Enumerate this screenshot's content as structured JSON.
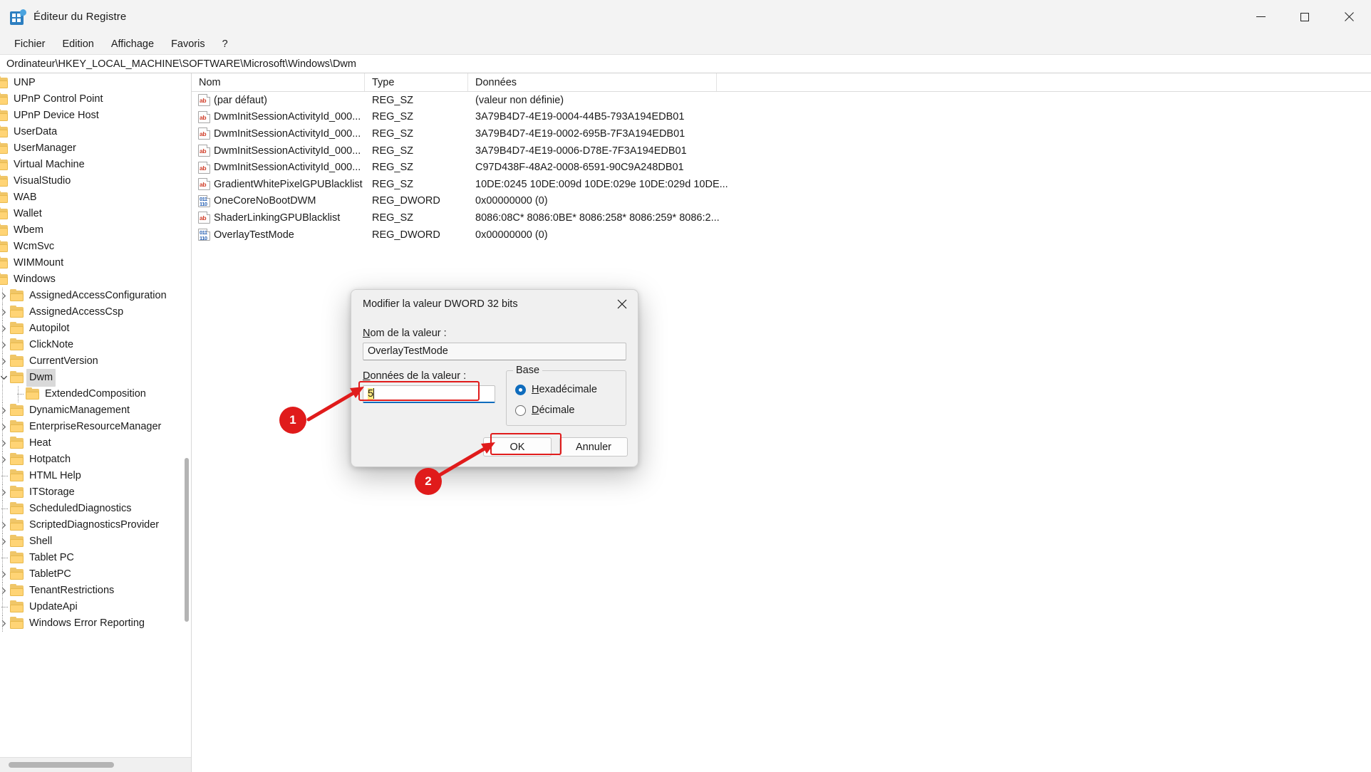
{
  "window": {
    "title": "Éditeur du Registre",
    "icon": "registry-editor-icon",
    "minimize_label": "Réduire",
    "maximize_label": "Agrandir",
    "close_label": "Fermer"
  },
  "menu": {
    "items": [
      {
        "label": "Fichier"
      },
      {
        "label": "Edition"
      },
      {
        "label": "Affichage"
      },
      {
        "label": "Favoris"
      },
      {
        "label": "?"
      }
    ]
  },
  "address": {
    "path": "Ordinateur\\HKEY_LOCAL_MACHINE\\SOFTWARE\\Microsoft\\Windows\\Dwm"
  },
  "tree": {
    "nodes": [
      {
        "label": "UNP",
        "indent": 1,
        "expander": "collapsed",
        "selected": false
      },
      {
        "label": "UPnP Control Point",
        "indent": 1,
        "expander": "none",
        "selected": false
      },
      {
        "label": "UPnP Device Host",
        "indent": 1,
        "expander": "collapsed",
        "selected": false
      },
      {
        "label": "UserData",
        "indent": 1,
        "expander": "none",
        "selected": false
      },
      {
        "label": "UserManager",
        "indent": 1,
        "expander": "collapsed",
        "selected": false
      },
      {
        "label": "Virtual Machine",
        "indent": 1,
        "expander": "collapsed",
        "selected": false
      },
      {
        "label": "VisualStudio",
        "indent": 1,
        "expander": "collapsed",
        "selected": false
      },
      {
        "label": "WAB",
        "indent": 1,
        "expander": "collapsed",
        "selected": false
      },
      {
        "label": "Wallet",
        "indent": 1,
        "expander": "none",
        "selected": false
      },
      {
        "label": "Wbem",
        "indent": 1,
        "expander": "collapsed",
        "selected": false
      },
      {
        "label": "WcmSvc",
        "indent": 1,
        "expander": "collapsed",
        "selected": false
      },
      {
        "label": "WIMMount",
        "indent": 1,
        "expander": "collapsed",
        "selected": false
      },
      {
        "label": "Windows",
        "indent": 1,
        "expander": "expanded",
        "selected": false
      },
      {
        "label": "AssignedAccessConfiguration",
        "indent": 2,
        "expander": "collapsed",
        "selected": false
      },
      {
        "label": "AssignedAccessCsp",
        "indent": 2,
        "expander": "collapsed",
        "selected": false
      },
      {
        "label": "Autopilot",
        "indent": 2,
        "expander": "collapsed",
        "selected": false
      },
      {
        "label": "ClickNote",
        "indent": 2,
        "expander": "collapsed",
        "selected": false
      },
      {
        "label": "CurrentVersion",
        "indent": 2,
        "expander": "collapsed",
        "selected": false
      },
      {
        "label": "Dwm",
        "indent": 2,
        "expander": "expanded",
        "selected": true
      },
      {
        "label": "ExtendedComposition",
        "indent": 3,
        "expander": "none",
        "selected": false
      },
      {
        "label": "DynamicManagement",
        "indent": 2,
        "expander": "collapsed",
        "selected": false
      },
      {
        "label": "EnterpriseResourceManager",
        "indent": 2,
        "expander": "collapsed",
        "selected": false
      },
      {
        "label": "Heat",
        "indent": 2,
        "expander": "collapsed",
        "selected": false
      },
      {
        "label": "Hotpatch",
        "indent": 2,
        "expander": "collapsed",
        "selected": false
      },
      {
        "label": "HTML Help",
        "indent": 2,
        "expander": "none",
        "selected": false
      },
      {
        "label": "ITStorage",
        "indent": 2,
        "expander": "collapsed",
        "selected": false
      },
      {
        "label": "ScheduledDiagnostics",
        "indent": 2,
        "expander": "none",
        "selected": false
      },
      {
        "label": "ScriptedDiagnosticsProvider",
        "indent": 2,
        "expander": "collapsed",
        "selected": false
      },
      {
        "label": "Shell",
        "indent": 2,
        "expander": "collapsed",
        "selected": false
      },
      {
        "label": "Tablet PC",
        "indent": 2,
        "expander": "none",
        "selected": false
      },
      {
        "label": "TabletPC",
        "indent": 2,
        "expander": "collapsed",
        "selected": false
      },
      {
        "label": "TenantRestrictions",
        "indent": 2,
        "expander": "collapsed",
        "selected": false
      },
      {
        "label": "UpdateApi",
        "indent": 2,
        "expander": "none",
        "selected": false
      },
      {
        "label": "Windows Error Reporting",
        "indent": 2,
        "expander": "collapsed",
        "selected": false
      }
    ]
  },
  "list": {
    "columns": [
      {
        "label": "Nom"
      },
      {
        "label": "Type"
      },
      {
        "label": "Données"
      }
    ],
    "rows": [
      {
        "icon": "string-value-icon",
        "name": "(par défaut)",
        "type": "REG_SZ",
        "data": "(valeur non définie)"
      },
      {
        "icon": "string-value-icon",
        "name": "DwmInitSessionActivityId_000...",
        "type": "REG_SZ",
        "data": "3A79B4D7-4E19-0004-44B5-793A194EDB01"
      },
      {
        "icon": "string-value-icon",
        "name": "DwmInitSessionActivityId_000...",
        "type": "REG_SZ",
        "data": "3A79B4D7-4E19-0002-695B-7F3A194EDB01"
      },
      {
        "icon": "string-value-icon",
        "name": "DwmInitSessionActivityId_000...",
        "type": "REG_SZ",
        "data": "3A79B4D7-4E19-0006-D78E-7F3A194EDB01"
      },
      {
        "icon": "string-value-icon",
        "name": "DwmInitSessionActivityId_000...",
        "type": "REG_SZ",
        "data": "C97D438F-48A2-0008-6591-90C9A248DB01"
      },
      {
        "icon": "string-value-icon",
        "name": "GradientWhitePixelGPUBlacklist",
        "type": "REG_SZ",
        "data": "10DE:0245 10DE:009d 10DE:029e 10DE:029d 10DE..."
      },
      {
        "icon": "dword-value-icon",
        "name": "OneCoreNoBootDWM",
        "type": "REG_DWORD",
        "data": "0x00000000 (0)"
      },
      {
        "icon": "string-value-icon",
        "name": "ShaderLinkingGPUBlacklist",
        "type": "REG_SZ",
        "data": "8086:08C* 8086:0BE* 8086:258* 8086:259* 8086:2..."
      },
      {
        "icon": "dword-value-icon",
        "name": "OverlayTestMode",
        "type": "REG_DWORD",
        "data": "0x00000000 (0)"
      }
    ]
  },
  "dialog": {
    "title": "Modifier la valeur DWORD 32 bits",
    "close_label": "Fermer",
    "name_label": "Nom de la valeur :",
    "name_label_accel": "N",
    "name_label_rest": "om de la valeur :",
    "name_value": "OverlayTestMode",
    "data_label": "Données de la valeur :",
    "data_label_accel": "D",
    "data_label_rest": "onnées de la valeur :",
    "data_value": "5",
    "base_group_label": "Base",
    "base_options": [
      {
        "label": "Hexadécimale",
        "accel": "H",
        "rest": "exadécimale",
        "checked": true
      },
      {
        "label": "Décimale",
        "accel": "D",
        "rest": "écimale",
        "checked": false
      }
    ],
    "ok_label": "OK",
    "cancel_label": "Annuler"
  },
  "annotations": {
    "accent_color": "#e01b1b",
    "steps": [
      {
        "number": "1",
        "target": "value-input"
      },
      {
        "number": "2",
        "target": "ok-button"
      }
    ]
  }
}
